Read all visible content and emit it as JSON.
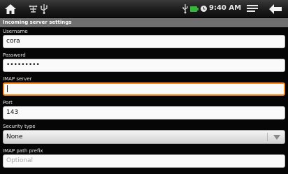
{
  "status_bar": {
    "icons": [
      "home-icon",
      "debug-icon",
      "usb-icon",
      "usb-storage-icon",
      "battery-icon",
      "alarm-icon",
      "menu-icon",
      "back-icon"
    ],
    "time": "9:40 AM"
  },
  "header": {
    "title": "Incoming server settings"
  },
  "form": {
    "username": {
      "label": "Username",
      "value": "cora"
    },
    "password": {
      "label": "Password",
      "value": "•••••••••"
    },
    "imap_server": {
      "label": "IMAP server",
      "value": ""
    },
    "port": {
      "label": "Port",
      "value": "143"
    },
    "security_type": {
      "label": "Security type",
      "value": "None"
    },
    "imap_path_prefix": {
      "label": "IMAP path prefix",
      "placeholder": "Optional"
    }
  },
  "colors": {
    "active_field_border": "#ff8c1a",
    "header_bg": "#6f6f6f"
  }
}
